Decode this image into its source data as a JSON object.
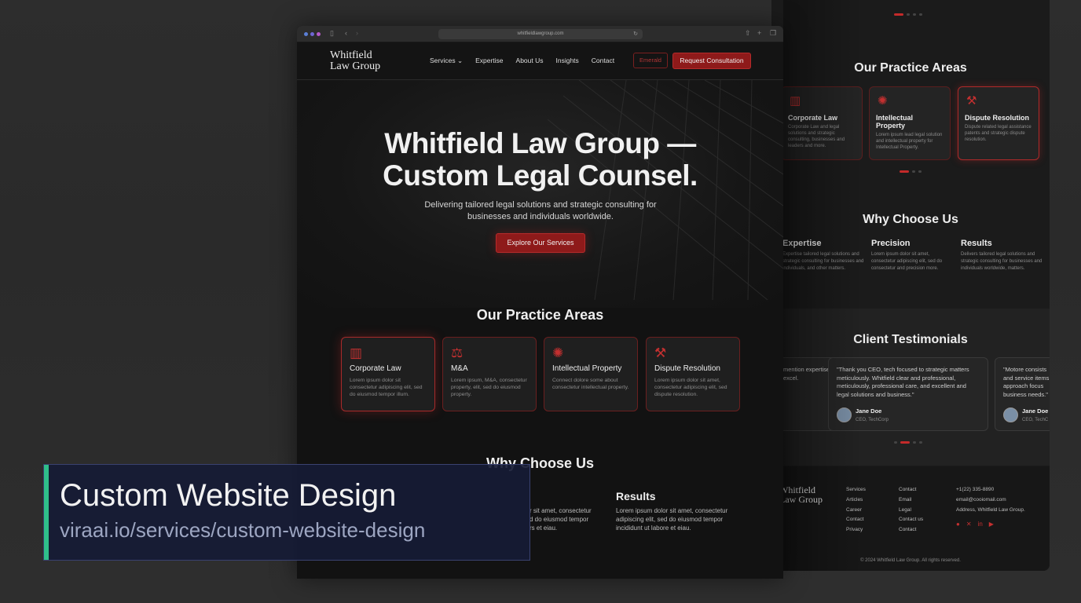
{
  "browser": {
    "url": "whitfieldlawgroup.com"
  },
  "nav": {
    "logo_line1": "Whitfield",
    "logo_line2": "Law Group",
    "links": [
      "Services",
      "Expertise",
      "About Us",
      "Insights",
      "Contact"
    ],
    "services_caret": "⌄",
    "emerald_label": "Emerald",
    "cta_label": "Request Consultation"
  },
  "hero": {
    "title_line1": "Whitfield Law Group —",
    "title_line2": "Custom Legal Counsel.",
    "subtitle_line1": "Delivering tailored legal solutions and strategic consulting for",
    "subtitle_line2": "businesses and individuals worldwide.",
    "cta_label": "Explore Our Services"
  },
  "practice": {
    "heading": "Our Practice Areas",
    "cards": [
      {
        "title": "Corporate Law",
        "icon": "building-icon",
        "desc": "Lorem ipsum dolor sit consectetur adipiscing elit, sed do eiusmod tempor illum."
      },
      {
        "title": "M&A",
        "icon": "scales-icon",
        "desc": "Lorem ipsum, M&A, consectetur property, elit, sed do eiusmod property."
      },
      {
        "title": "Intellectual Property",
        "icon": "lightbulb-icon",
        "desc": "Connect dolore some about consectetur intellectual property."
      },
      {
        "title": "Dispute Resolution",
        "icon": "gavel-icon",
        "desc": "Lorem ipsum dolor sit amet, consectetur adipiscing elit, sed dispute resolution."
      }
    ]
  },
  "why": {
    "heading": "Why Choose Us",
    "main_items": [
      {
        "title": "Results",
        "desc_line1": "Lorem ipsum dolor sit amet, consectetur",
        "desc_line2": "adipiscing elit, sed do eiusmod tempor",
        "desc_line3": "incididunt ut labore et eiau."
      }
    ],
    "partial_line1": "r sit amet, consectetur",
    "partial_line2": "d do eiusmod tempor",
    "partial_line3": "rs et eiau."
  },
  "backdrop": {
    "practice_heading": "Our Practice Areas",
    "cards": [
      {
        "title": "Corporate Law",
        "desc": "Corporate Law and legal solutions and strategic consulting, businesses and leaders and more."
      },
      {
        "title": "Intellectual Property",
        "desc": "Lorem ipsum lead legal solution and intellectual property for Intellectual Property."
      },
      {
        "title": "Dispute Resolution",
        "desc": "Dispute related legal assistance patents and strategic dispute resolution."
      }
    ],
    "why_heading": "Why Choose Us",
    "why_items": [
      {
        "title": "Expertise",
        "desc": "Expertise tailored legal solutions and strategic consulting for businesses and individuals, and other matters."
      },
      {
        "title": "Precision",
        "desc": "Lorem ipsum dolor sit amet, consectetur adipiscing elit, sed do consectetur and precision more."
      },
      {
        "title": "Results",
        "desc": "Delivers tailored legal solutions and strategic consulting for businesses and individuals worldwide, matters."
      }
    ],
    "testimonials_heading": "Client Testimonials",
    "testimonials": [
      {
        "quote": "\"Thank you CEO, tech focused to strategic matters meticulously. Whitfield clear and professional, meticulously, professional care, and excellent and legal solutions and business.\"",
        "name": "Jane Doe",
        "role": "CEO, TechCorp"
      },
      {
        "quote": "\"Motore consists and service items approach focus business needs.\"",
        "name": "Jane Doe",
        "role": "CEO, TechC"
      }
    ],
    "left_partial_quote": "mention expertise excel.",
    "footer": {
      "logo_line1": "Whitfield",
      "logo_line2": "Law Group",
      "col1": [
        "Services",
        "Articles",
        "Career",
        "Contact",
        "Privacy"
      ],
      "col2": [
        "Contact",
        "Email",
        "Legal",
        "Contact us",
        "Contact"
      ],
      "col3": [
        "+1(22) 335-8890",
        "email@cooiomail.com",
        "Address, Whitfield Law Group."
      ],
      "copyright": "© 2024 Whitfield Law Group. All rights reserved."
    }
  },
  "caption": {
    "title": "Custom Website Design",
    "url": "viraai.io/services/custom-website-design"
  },
  "colors": {
    "accent": "#8e1a1a",
    "caption_bar": "#2fbf8a",
    "caption_bg": "#161b35"
  }
}
